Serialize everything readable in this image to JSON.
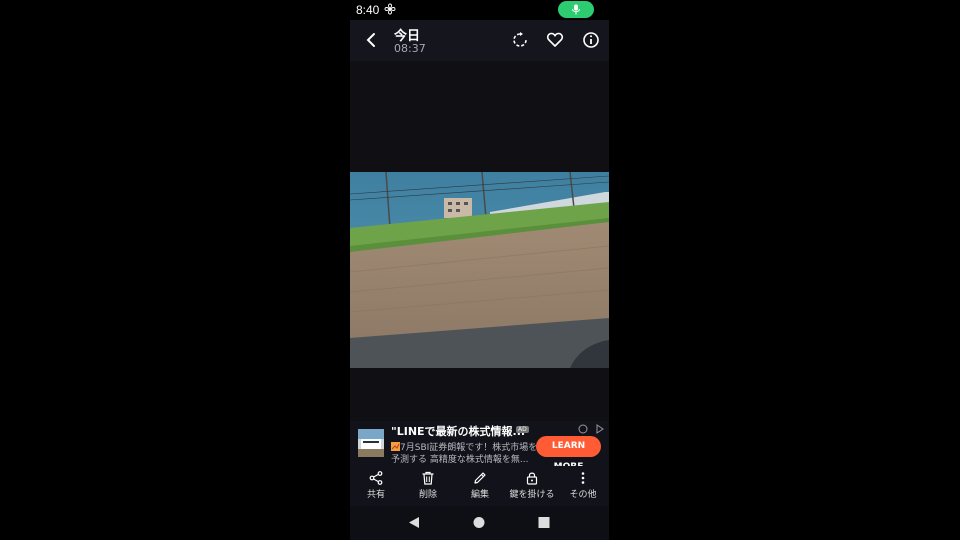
{
  "status_bar": {
    "time": "8:40"
  },
  "header": {
    "title": "今日",
    "subtitle": "08:37"
  },
  "ad": {
    "title": "\"LINEで最新の株式情報...",
    "badge": "AD",
    "line1": "7月SBI証券朗報です！株式市場を",
    "line2": "予測する 高精度な株式情報を無...",
    "cta": "LEARN MORE"
  },
  "toolbar": {
    "share": "共有",
    "delete": "削除",
    "edit": "編集",
    "lock": "鍵を掛ける",
    "more": "その他"
  },
  "colors": {
    "accent_green": "#2ecc71",
    "cta_orange": "#ff5c35",
    "bar_bg": "#15151e"
  }
}
